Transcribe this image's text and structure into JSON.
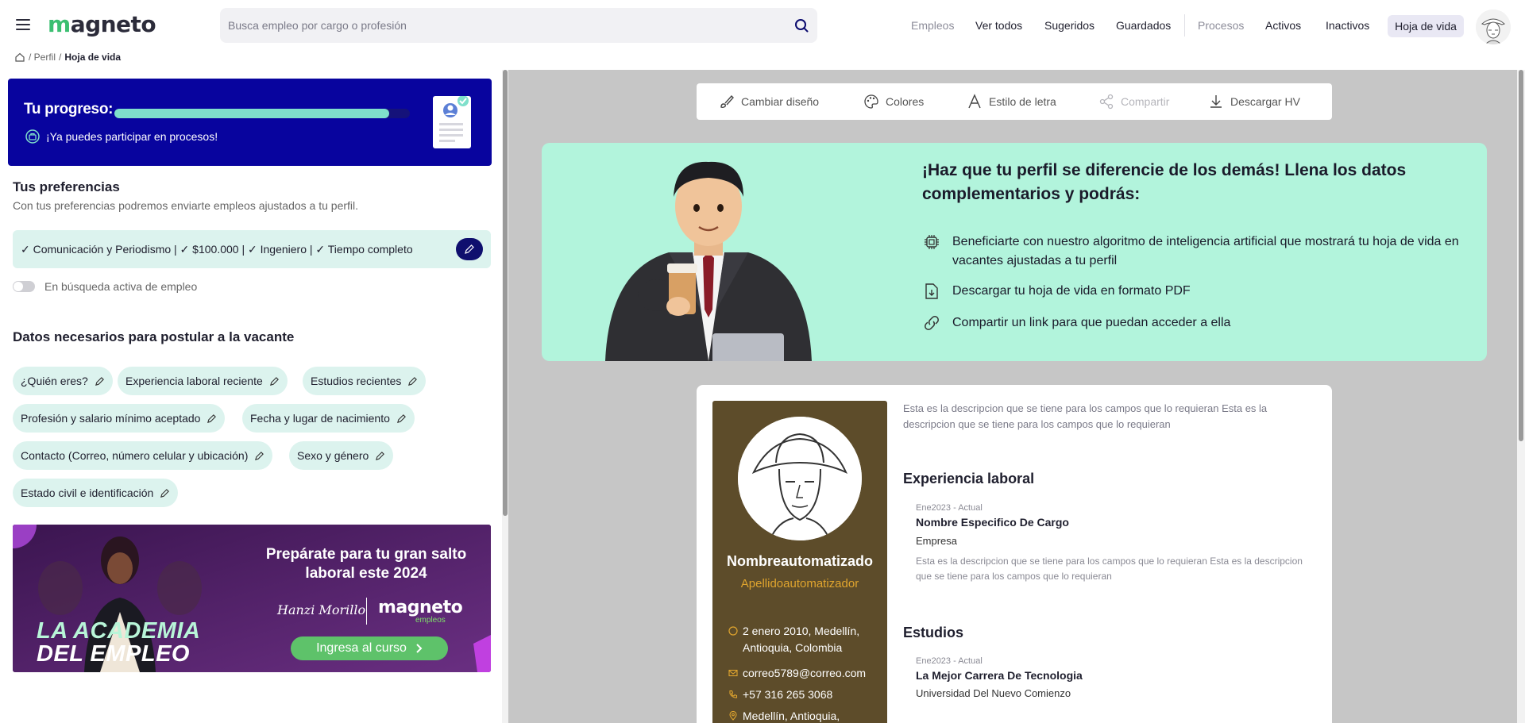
{
  "header": {
    "logo_text": "magneto",
    "search_placeholder": "Busca empleo por cargo o profesión",
    "nav": {
      "empleos": "Empleos",
      "ver_todos": "Ver todos",
      "sugeridos": "Sugeridos",
      "guardados": "Guardados",
      "procesos": "Procesos",
      "activos": "Activos",
      "inactivos": "Inactivos",
      "hoja_de_vida": "Hoja de vida"
    }
  },
  "breadcrumb": {
    "perfil": "/ Perfil",
    "sep": "/",
    "current": "Hoja de vida"
  },
  "progress": {
    "title": "Tu progreso:",
    "percent": 93,
    "message": "¡Ya puedes participar en procesos!"
  },
  "preferences": {
    "title": "Tus preferencias",
    "subtitle": "Con tus preferencias podremos enviarte empleos ajustados a tu perfil.",
    "summary": "✓ Comunicación y Periodismo | ✓ $100.000 | ✓ Ingeniero | ✓ Tiempo completo",
    "active_search_label": "En búsqueda activa de empleo",
    "active_search_on": false
  },
  "datos": {
    "title": "Datos necesarios para postular a la vacante",
    "chips": [
      "¿Quién eres?",
      "Experiencia laboral reciente",
      "Estudios recientes",
      "Profesión y salario mínimo aceptado",
      "Fecha y lugar de nacimiento",
      "Contacto (Correo, número celular y ubicación)",
      "Sexo y género",
      "Estado civil e identificación"
    ]
  },
  "banner": {
    "headline": "Prepárate para tu gran salto laboral este 2024",
    "signature": "Hanzi Morillo",
    "brand": "magneto",
    "brand_sub": "empleos",
    "academy_line1": "LA ACADEMIA",
    "academy_line2": "DEL EMPLEO",
    "cta": "Ingresa al curso"
  },
  "toolbar": {
    "cambiar_diseno": "Cambiar diseño",
    "colores": "Colores",
    "estilo_letra": "Estilo de letra",
    "compartir": "Compartir",
    "descargar": "Descargar HV"
  },
  "promo": {
    "title": "¡Haz que tu perfil se diferencie de los demás! Llena los datos complementarios y podrás:",
    "benefits": [
      "Beneficiarte con nuestro algoritmo de inteligencia artificial que mostrará tu hoja de vida en vacantes ajustadas a tu perfil",
      "Descargar tu hoja de vida en formato PDF",
      "Compartir un link para que puedan acceder a ella"
    ]
  },
  "cv": {
    "first_name": "Nombreautomatizado",
    "last_name": "Apellidoautomatizador",
    "birth": "2 enero 2010, Medellín, Antioquia, Colombia",
    "email": "correo5789@correo.com",
    "phone": "+57 316 265 3068",
    "location": "Medellín, Antioquia, Colombia",
    "profile_desc": "Esta es la descripcion que se tiene para los campos que lo requieran Esta es la descripcion que se tiene para los campos que lo requieran",
    "experience_title": "Experiencia laboral",
    "experience": {
      "date": "Ene2023 - Actual",
      "role": "Nombre Especifico De Cargo",
      "company": "Empresa",
      "desc": "Esta es la descripcion que se tiene para los campos que lo requieran Esta es la descripcion que se tiene para los campos que lo requieran"
    },
    "studies_title": "Estudios",
    "studies": {
      "date": "Ene2023 - Actual",
      "degree": "La Mejor Carrera De Tecnologia",
      "school": "Universidad Del Nuevo Comienzo"
    }
  },
  "colors": {
    "primary_dark": "#08049e",
    "progress_fill": "#7fe0cb",
    "mint": "#dcf3ee",
    "promo_bg": "#b2f4dc",
    "cv_sidebar": "#5d4c2a",
    "accent_gold": "#e0a52e",
    "cta_green": "#5ec26a",
    "banner_purple": "#5a2970"
  }
}
